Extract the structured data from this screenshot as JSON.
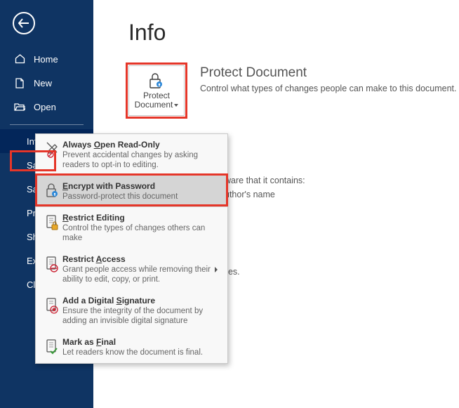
{
  "sidebar": {
    "items": [
      {
        "label": "Home"
      },
      {
        "label": "New"
      },
      {
        "label": "Open"
      },
      {
        "label": "Info"
      },
      {
        "label": "Save"
      },
      {
        "label": "Save As"
      },
      {
        "label": "Print"
      },
      {
        "label": "Share"
      },
      {
        "label": "Export"
      },
      {
        "label": "Close"
      }
    ]
  },
  "page": {
    "title": "Info"
  },
  "protect": {
    "button_line1": "Protect",
    "button_line2": "Document",
    "heading": "Protect Document",
    "description": "Control what types of changes people can make to this document."
  },
  "behind": {
    "line1": "ware that it contains:",
    "line2": "uthor's name",
    "line3": "ges."
  },
  "menu": {
    "items": [
      {
        "title_pre": "Always ",
        "title_ul": "O",
        "title_post": "pen Read-Only",
        "desc": "Prevent accidental changes by asking readers to opt-in to editing."
      },
      {
        "title_pre": "",
        "title_ul": "E",
        "title_post": "ncrypt with Password",
        "desc": "Password-protect this document"
      },
      {
        "title_pre": "",
        "title_ul": "R",
        "title_post": "estrict Editing",
        "desc": "Control the types of changes others can make"
      },
      {
        "title_pre": "Restrict ",
        "title_ul": "A",
        "title_post": "ccess",
        "desc": "Grant people access while removing their ability to edit, copy, or print."
      },
      {
        "title_pre": "Add a Digital ",
        "title_ul": "S",
        "title_post": "ignature",
        "desc": "Ensure the integrity of the document by adding an invisible digital signature"
      },
      {
        "title_pre": "Mark as ",
        "title_ul": "F",
        "title_post": "inal",
        "desc": "Let readers know the document is final."
      }
    ]
  }
}
